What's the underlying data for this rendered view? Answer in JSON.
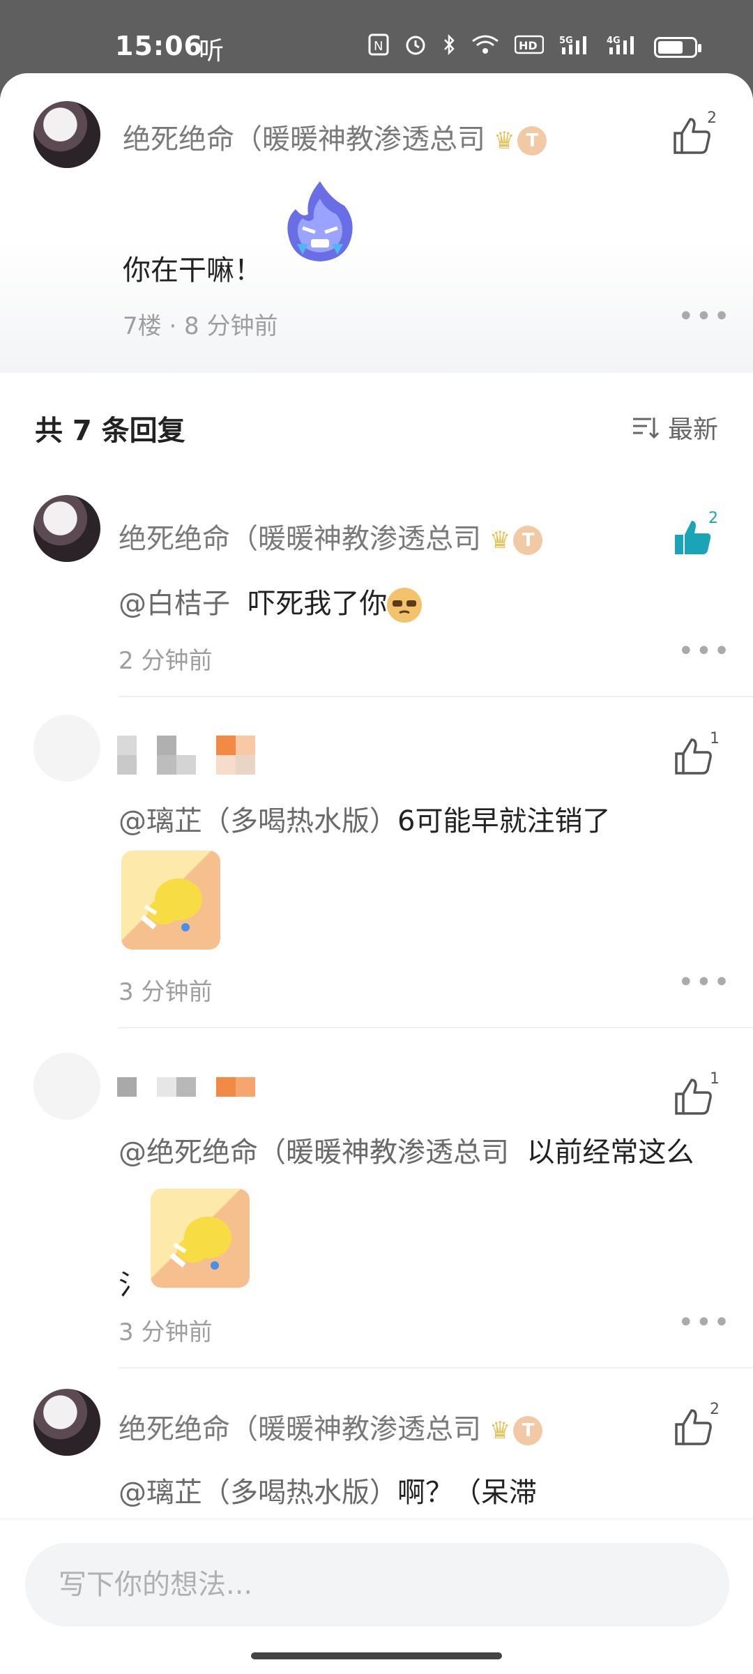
{
  "status_bar": {
    "time": "15:06",
    "listen": "听",
    "icons": [
      "nfc-icon",
      "alarm-icon",
      "bluetooth-icon",
      "wifi-icon",
      "hd-icon",
      "5g-signal-icon",
      "4g-signal-icon",
      "battery-icon"
    ],
    "battery_level": 0.7
  },
  "parent_comment": {
    "author": "绝死绝命（暖暖神教渗透总司",
    "text": "你在干嘛！",
    "meta": "7楼 · 8 分钟前",
    "likes": "2"
  },
  "replies_header": {
    "title": "共 7 条回复",
    "sort_label": "最新"
  },
  "replies": [
    {
      "author": "绝死绝命（暖暖神教渗透总司",
      "mention": "@白桔子",
      "text": "吓死我了你",
      "time": "2 分钟前",
      "likes": "2"
    },
    {
      "mention": "@璃芷（多喝热水版）",
      "text": "6可能早就注销了",
      "time": "3 分钟前",
      "likes": "1"
    },
    {
      "mention": "@绝死绝命（暖暖神教渗透总司",
      "text": "以前经常这么",
      "tail": "氵",
      "time": "3 分钟前",
      "likes": "1"
    },
    {
      "author": "绝死绝命（暖暖神教渗透总司",
      "mention": "@璃芷（多喝热水版）",
      "text": "啊？（呆滞",
      "likes": "2"
    }
  ],
  "input": {
    "placeholder": "写下你的想法..."
  },
  "colors": {
    "accent_like": "#1ba3b8",
    "status_bar_bg": "#5f5f5f"
  }
}
